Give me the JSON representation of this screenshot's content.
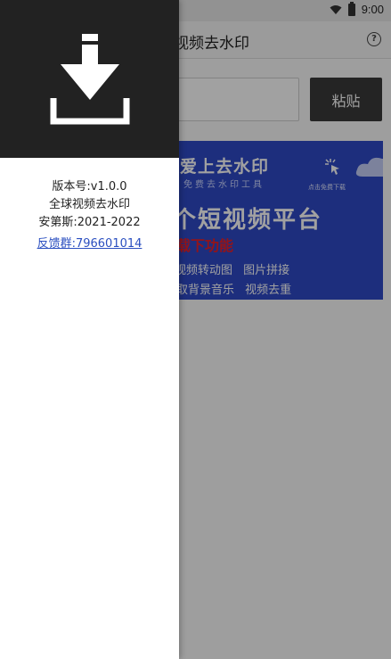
{
  "status_bar": {
    "time": "9:00"
  },
  "toolbar": {
    "title": "视频去水印"
  },
  "input": {
    "placeholder": ""
  },
  "paste_button": {
    "label": "粘贴"
  },
  "banner": {
    "brand": "爱上去水印",
    "slogan": "免费去水印工具",
    "cta": "点击免费下载",
    "headline": "个短视频平台",
    "subline": "载下功能",
    "features_row1": "视频转动图 图片拼接",
    "features_row2": "取背景音乐 视频去重",
    "color": "#2e49c7"
  },
  "drawer": {
    "version": "版本号:v1.0.0",
    "app_name": "全球视频去水印",
    "copyright": "安第斯:2021-2022",
    "feedback_link": "反馈群:796601014",
    "header_color": "#222222"
  }
}
